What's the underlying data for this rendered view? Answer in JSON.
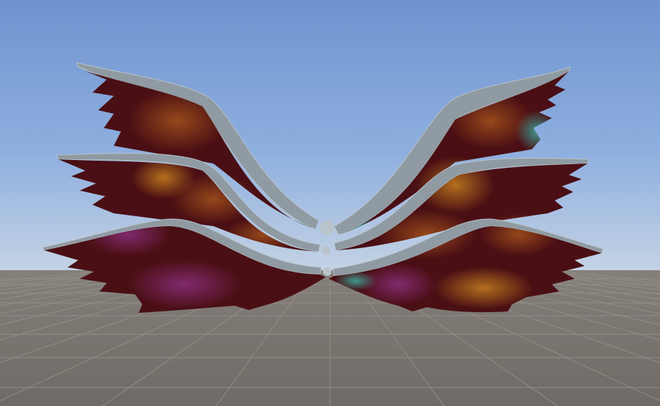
{
  "scene": {
    "subject": "winged-sculpture",
    "background": "sky-and-ground-grid"
  },
  "colors": {
    "sky_top": "#6f93cf",
    "sky_mid": "#8fb0df",
    "sky_horizon": "#c9d6e6",
    "ground": "#706a66",
    "ground_far": "#857f7a",
    "grid_line": "#938d88",
    "rim": "#8f9aa2",
    "rim_light": "#b9c3ca",
    "texture_dark": "#4a0f14",
    "texture_amber": "#c07a1e",
    "texture_orange": "#a4521c",
    "texture_magenta": "#8b2f7d",
    "texture_teal": "#3fa59a"
  }
}
